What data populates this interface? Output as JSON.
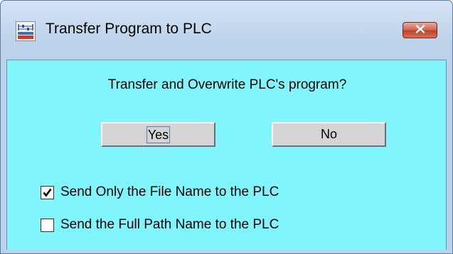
{
  "window": {
    "title": "Transfer Program to PLC",
    "icon": "plc-ladder-app-icon",
    "close_icon": "close-x-icon"
  },
  "dialog": {
    "question": "Transfer and Overwrite PLC's program?",
    "buttons": {
      "yes_label": "Yes",
      "no_label": "No"
    },
    "options": [
      {
        "label": "Send Only the File Name to the PLC",
        "checked": true
      },
      {
        "label": "Send the Full Path Name to the PLC",
        "checked": false
      }
    ]
  },
  "colors": {
    "client_background": "#80f5fb",
    "button_face": "#d4d4d4",
    "close_button": "#c0412a",
    "titlebar": "#bcd2ea"
  }
}
